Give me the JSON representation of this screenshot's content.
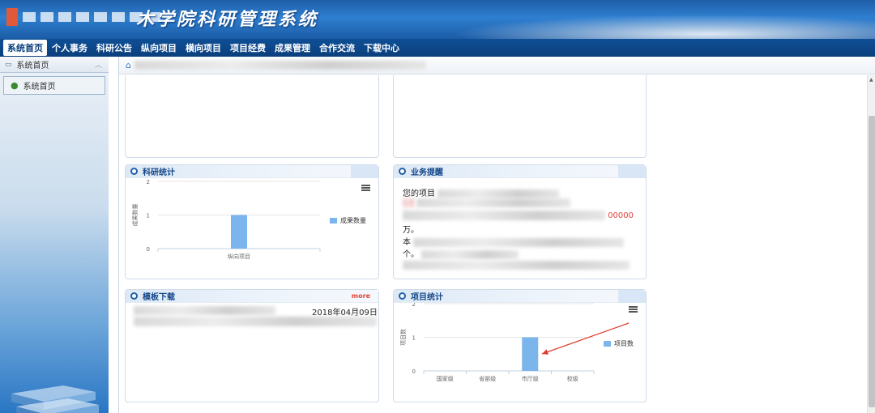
{
  "header": {
    "title": "木学院科研管理系统"
  },
  "nav": {
    "items": [
      "系统首页",
      "个人事务",
      "科研公告",
      "纵向项目",
      "横向项目",
      "项目经费",
      "成果管理",
      "合作交流",
      "下载中心"
    ]
  },
  "sidebar": {
    "section_title": "系统首页",
    "items": [
      {
        "label": "系统首页"
      }
    ]
  },
  "panels": {
    "research_stats": {
      "title": "科研统计"
    },
    "business_reminder": {
      "title": "业务提醒",
      "line1_prefix": "您的项目",
      "line2_value": "00000",
      "line3": "万。",
      "line4_prefix": "本",
      "line5": "个。"
    },
    "template_download": {
      "title": "模板下载",
      "more": "more",
      "date": "2018年04月09日"
    },
    "project_stats": {
      "title": "项目统计"
    }
  },
  "chart_data": [
    {
      "type": "bar",
      "ylabel": "成果数量",
      "categories": [
        "纵向项目"
      ],
      "series": [
        {
          "name": "成果数量",
          "values": [
            1
          ]
        }
      ],
      "ylim": [
        0,
        2
      ],
      "yticks": [
        0,
        1,
        2
      ],
      "legend": "right",
      "color": "#7cb5ec"
    },
    {
      "type": "bar",
      "ylabel": "项目数",
      "categories": [
        "国家级",
        "省部级",
        "市厅级",
        "校级"
      ],
      "series": [
        {
          "name": "项目数",
          "values": [
            0,
            0,
            1,
            0
          ]
        }
      ],
      "ylim": [
        0,
        2
      ],
      "yticks": [
        0,
        1,
        2
      ],
      "legend": "right",
      "color": "#7cb5ec"
    }
  ],
  "colors": {
    "header_blue": "#1e5ea8",
    "nav_blue": "#0a3f7c",
    "bar": "#7cb5ec",
    "accent_red": "#e0433b",
    "panel_title": "#14488a"
  },
  "icons": {
    "home": "home-icon",
    "user": "user-icon",
    "menu": "hamburger-menu-icon",
    "collapse": "collapse-chevron-icon"
  }
}
